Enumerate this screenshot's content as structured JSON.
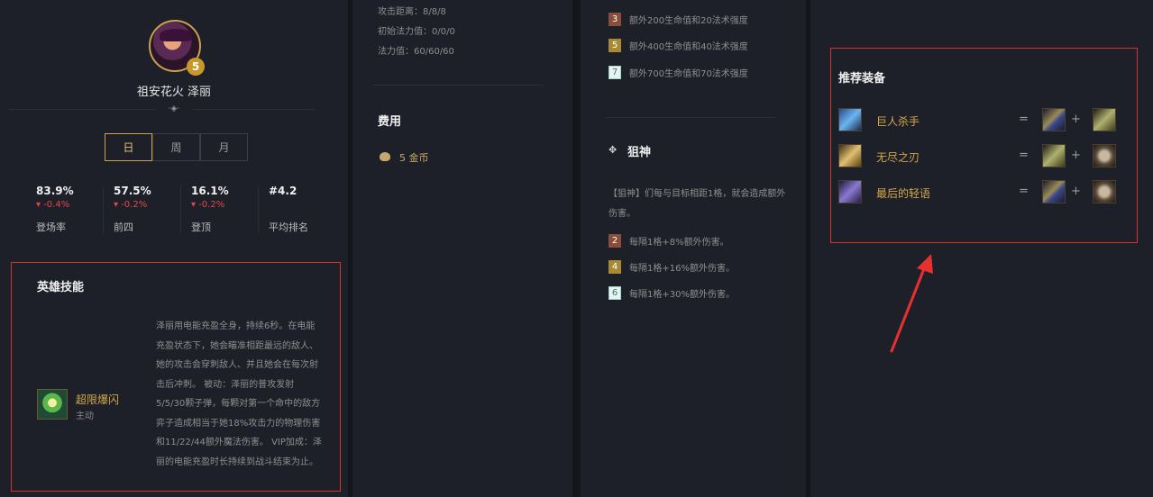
{
  "hero": {
    "name": "祖安花火 泽丽",
    "star": "5",
    "ornament": "·◈·"
  },
  "period_tabs": [
    "日",
    "周",
    "月"
  ],
  "period_selected": "日",
  "stats": [
    {
      "value": "83.9%",
      "change": "▾ -0.4%",
      "label": "登场率"
    },
    {
      "value": "57.5%",
      "change": "▾ -0.2%",
      "label": "前四"
    },
    {
      "value": "16.1%",
      "change": "▾ -0.2%",
      "label": "登顶"
    },
    {
      "value": "#4.2",
      "change": "",
      "label": "平均排名"
    }
  ],
  "skill": {
    "section_title": "英雄技能",
    "name": "超限爆闪",
    "type": "主动",
    "description": "泽丽用电能充盈全身，持续6秒。在电能充盈状态下，她会瞄准相距最远的敌人、她的攻击会穿刺敌人、并且她会在每次射击后冲刺。 被动：泽丽的普攻发射5/5/30颗子弹，每颗对第一个命中的敌方弈子造成相当于她18%攻击力的物理伤害和11/22/44额外魔法伤害。 VIP加成：泽丽的电能充盈时长持续到战斗结束为止。"
  },
  "attributes": [
    "攻击距离：8/8/8",
    "初始法力值：0/0/0",
    "法力值：60/60/60"
  ],
  "cost": {
    "title": "费用",
    "text": "5 金币"
  },
  "trait_bonus_top": [
    {
      "tier": "3",
      "style": "bronze",
      "text": "额外200生命值和20法术强度"
    },
    {
      "tier": "5",
      "style": "gold",
      "text": "额外400生命值和40法术强度"
    },
    {
      "tier": "7",
      "style": "prism",
      "text": "额外700生命值和70法术强度"
    }
  ],
  "trait": {
    "icon": "✥",
    "name": "狙神",
    "description": "【狙神】们每与目标相距1格，就会造成额外伤害。",
    "tiers": [
      {
        "tier": "2",
        "style": "bronze",
        "text": "每隔1格+8%额外伤害。"
      },
      {
        "tier": "4",
        "style": "gold",
        "text": "每隔1格+16%额外伤害。"
      },
      {
        "tier": "6",
        "style": "prism",
        "text": "每隔1格+30%额外伤害。"
      }
    ]
  },
  "items": {
    "section_title": "推荐装备",
    "equals": "=",
    "plus": "+",
    "rows": [
      {
        "name": "巨人杀手",
        "icon": "giant-slayer-icon",
        "part_a": "recurve-bow-icon",
        "part_b": "bf-sword-icon"
      },
      {
        "name": "无尽之刃",
        "icon": "infinity-edge-icon",
        "part_a": "bf-sword-icon",
        "part_b": "sparring-gloves-icon"
      },
      {
        "name": "最后的轻语",
        "icon": "last-whisper-icon",
        "part_a": "recurve-bow-icon",
        "part_b": "sparring-gloves-icon"
      }
    ]
  },
  "colors": {
    "background": "#14161c",
    "panel": "#1e2029",
    "accent_gold": "#c8a24c",
    "highlight_red": "#d9312f",
    "negative": "#e04848"
  }
}
